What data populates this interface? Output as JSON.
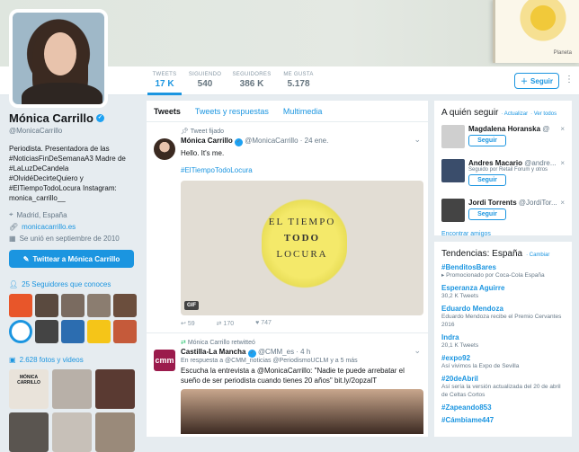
{
  "navbar": {
    "stats": [
      {
        "label": "TWEETS",
        "value": "17 K",
        "active": true
      },
      {
        "label": "SIGUIENDO",
        "value": "540"
      },
      {
        "label": "SEGUIDORES",
        "value": "386 K"
      },
      {
        "label": "ME GUSTA",
        "value": "5.178"
      }
    ],
    "follow_label": "Seguir",
    "more_icon": "⋮"
  },
  "banner": {
    "publisher": "Planeta"
  },
  "profile": {
    "name": "Mónica Carrillo",
    "handle": "@MonicaCarrillo",
    "bio": "Periodista. Presentadora de las #NoticiasFinDeSemanaA3 Madre de #LaLuzDeCandela #OlvidéDecirteQuiero y #ElTiempoTodoLocura Instagram: monica_carrillo__",
    "location": "Madrid, España",
    "website": "monicacarrillo.es",
    "joined": "Se unió en septiembre de 2010",
    "tweet_to_label": "Twittear a Mónica Carrillo",
    "followers_known": "25 Seguidores que conoces",
    "photos_videos": "2.628 fotos y videos",
    "photo_title": "MÓNICA CARRILLO"
  },
  "timeline": {
    "tabs": [
      "Tweets",
      "Tweets y respuestas",
      "Multimedia"
    ],
    "tweet1": {
      "context": "Tweet fijado",
      "name": "Mónica Carrillo",
      "handle": "@MonicaCarrillo",
      "date": "· 24 ene.",
      "text": "Hello. It's me.",
      "hashtag": "#ElTiempoTodoLocura",
      "media_lines": [
        "EL TIEMPO",
        "TODO",
        "LOCURA"
      ],
      "gif_label": "GIF",
      "replies": "59",
      "retweets": "170",
      "likes": "747"
    },
    "tweet2": {
      "context": "Mónica Carrillo retwitteó",
      "name": "Castilla-La Mancha",
      "handle": "@CMM_es",
      "date": "· 4 h",
      "reply_to": "En respuesta a @CMM_noticias @PeriodismoUCLM y a 5 más",
      "text": "Escucha la entrevista a @MonicaCarrillo: \"Nadie te puede arrebatar el sueño de ser periodista cuando tienes 20 años\" bit.ly/2opzalT",
      "avatar_text": "cmm"
    }
  },
  "who_to_follow": {
    "title": "A quién seguir",
    "refresh": "· Actualizar",
    "view_all": "· Ver todos",
    "items": [
      {
        "name": "Magdalena Horanska",
        "handle": "@",
        "sub": "",
        "follow": "Seguir"
      },
      {
        "name": "Andres Macario",
        "handle": "@andre...",
        "sub": "Seguido por Retail Forum y otros",
        "follow": "Seguir"
      },
      {
        "name": "Jordi Torrents",
        "handle": "@JordiTor...",
        "sub": "",
        "follow": "Seguir"
      }
    ],
    "find_friends": "Encontrar amigos",
    "close_icon": "×"
  },
  "trends": {
    "title": "Tendencias: España",
    "change": "· Cambiar",
    "items": [
      {
        "name": "#BenditosBares",
        "desc": "Promocionado por Coca-Cola España"
      },
      {
        "name": "Esperanza Aguirre",
        "desc": "30,2 K Tweets"
      },
      {
        "name": "Eduardo Mendoza",
        "desc": "Eduardo Mendoza recibe el Premio Cervantes 2016"
      },
      {
        "name": "Indra",
        "desc": "20,1 K Tweets"
      },
      {
        "name": "#expo92",
        "desc": "Así vivimos la Expo de Sevilla"
      },
      {
        "name": "#20deAbril",
        "desc": "Así sería la versión actualizada del 20 de abril de Celtas Cortos"
      },
      {
        "name": "#Zapeando853",
        "desc": ""
      },
      {
        "name": "#Cámbiame447",
        "desc": ""
      }
    ]
  }
}
